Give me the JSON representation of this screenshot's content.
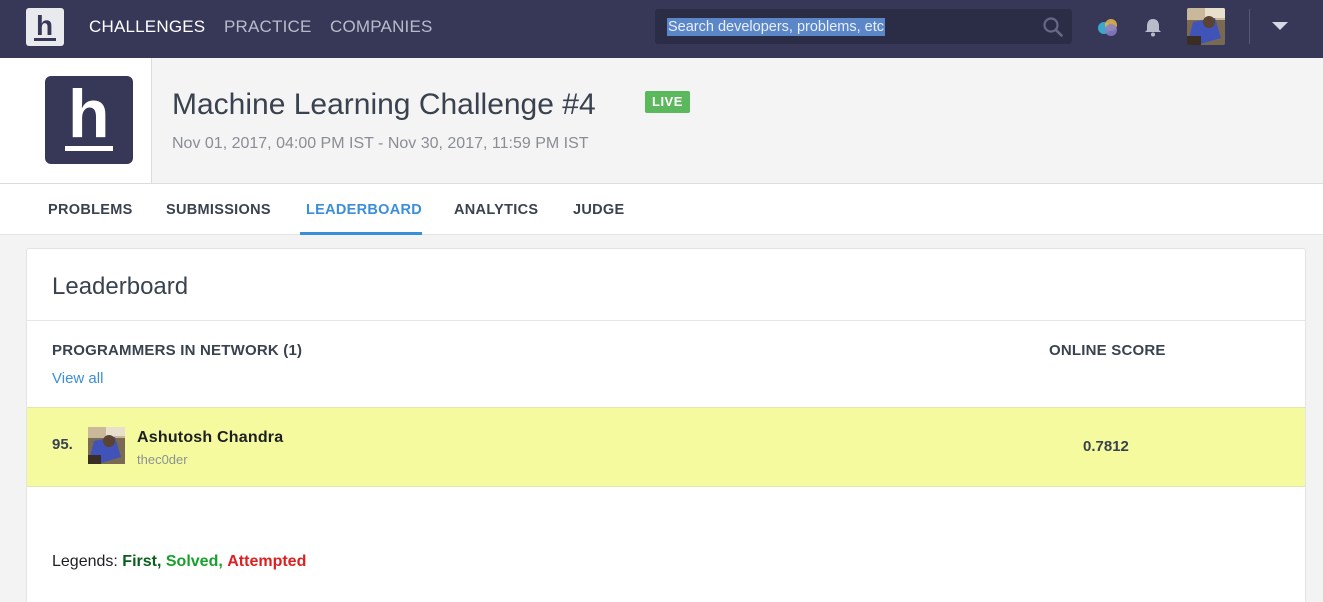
{
  "nav": {
    "links": [
      "CHALLENGES",
      "PRACTICE",
      "COMPANIES"
    ],
    "search_placeholder": "Search developers, problems, etc",
    "logo_letter": "h"
  },
  "contest": {
    "title": "Machine Learning Challenge #4",
    "status": "LIVE",
    "dates": "Nov 01, 2017, 04:00 PM IST - Nov 30, 2017, 11:59 PM IST",
    "logo_letter": "h"
  },
  "tabs": [
    "PROBLEMS",
    "SUBMISSIONS",
    "LEADERBOARD",
    "ANALYTICS",
    "JUDGE"
  ],
  "leaderboard": {
    "title": "Leaderboard",
    "network_heading": "PROGRAMMERS IN NETWORK (1)",
    "score_heading": "ONLINE SCORE",
    "view_all": "View all",
    "rows": [
      {
        "rank": "95.",
        "name": "Ashutosh Chandra",
        "handle": "thec0der",
        "score": "0.7812"
      }
    ],
    "legend_label": "Legends:",
    "legend_first": "First,",
    "legend_solved": "Solved,",
    "legend_attempted": "Attempted"
  },
  "colors": {
    "navbar": "#373858",
    "accent": "#3b8ed8",
    "live": "#5cb85c",
    "highlight_row": "#f4fa9d"
  }
}
